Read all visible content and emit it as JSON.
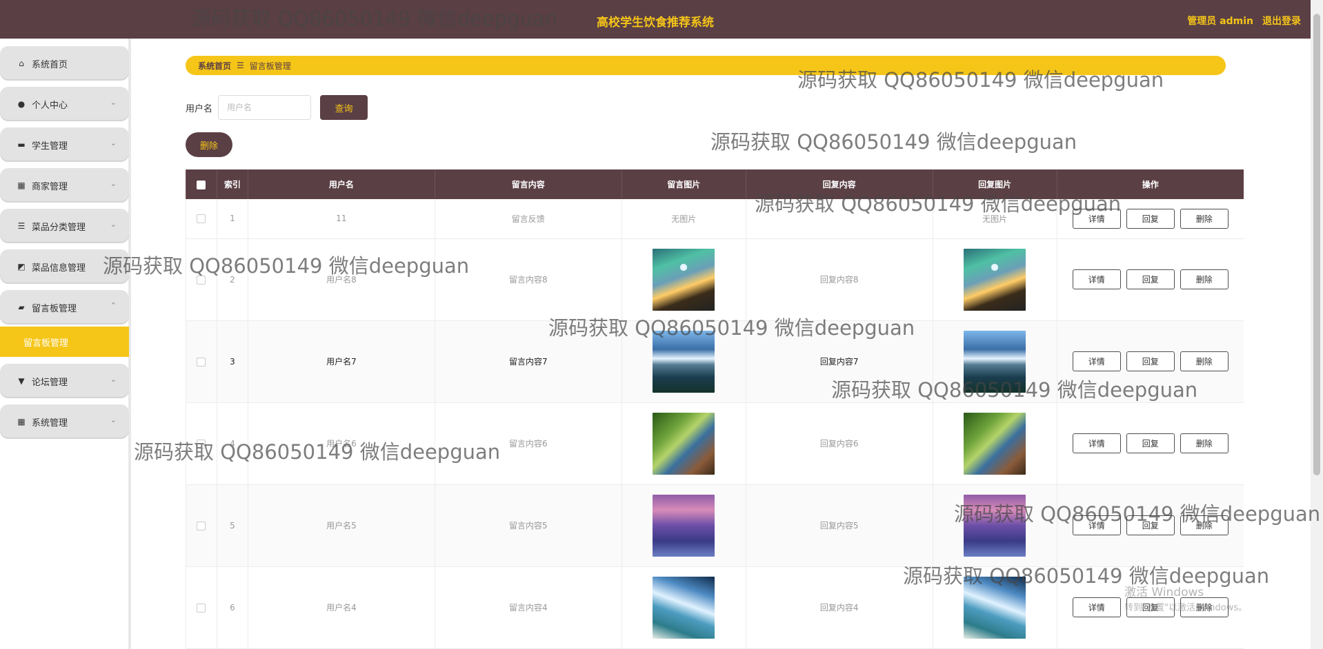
{
  "header": {
    "title": "高校学生饮食推荐系统",
    "admin_label": "管理员 admin",
    "logout_label": "退出登录"
  },
  "sidebar": {
    "items": [
      {
        "label": "系统首页",
        "icon": "home-icon",
        "expandable": false
      },
      {
        "label": "个人中心",
        "icon": "user-icon",
        "expandable": true
      },
      {
        "label": "学生管理",
        "icon": "monitor-icon",
        "expandable": true
      },
      {
        "label": "商家管理",
        "icon": "grid-icon",
        "expandable": true
      },
      {
        "label": "菜品分类管理",
        "icon": "list-icon",
        "expandable": true
      },
      {
        "label": "菜品信息管理",
        "icon": "chart-icon",
        "expandable": true
      },
      {
        "label": "留言板管理",
        "icon": "ticket-icon",
        "expandable": true,
        "expanded": true
      },
      {
        "label": "论坛管理",
        "icon": "pin-icon",
        "expandable": true
      },
      {
        "label": "系统管理",
        "icon": "grid-icon",
        "expandable": true
      }
    ],
    "active_sub_item": "留言板管理"
  },
  "breadcrumb": {
    "home": "系统首页",
    "separator": "☰",
    "current": "留言板管理"
  },
  "search": {
    "label": "用户名",
    "placeholder": "用户名",
    "query_button": "查询",
    "delete_button": "删除"
  },
  "table": {
    "columns": [
      "索引",
      "用户名",
      "留言内容",
      "留言图片",
      "回复内容",
      "回复图片",
      "操作"
    ],
    "actions": [
      "详情",
      "回复",
      "删除"
    ],
    "rows": [
      {
        "index": "1",
        "username": "11",
        "content": "留言反馈",
        "image_text": "无图片",
        "reply": "",
        "reply_image_text": "无图片"
      },
      {
        "index": "2",
        "username": "用户名8",
        "content": "留言内容8",
        "image": "img1",
        "reply": "回复内容8",
        "reply_image": "img1"
      },
      {
        "index": "3",
        "username": "用户名7",
        "content": "留言内容7",
        "image": "img2",
        "reply": "回复内容7",
        "reply_image": "img2"
      },
      {
        "index": "4",
        "username": "用户名6",
        "content": "留言内容6",
        "image": "img3",
        "reply": "回复内容6",
        "reply_image": "img3"
      },
      {
        "index": "5",
        "username": "用户名5",
        "content": "留言内容5",
        "image": "img4",
        "reply": "回复内容5",
        "reply_image": "img4"
      },
      {
        "index": "6",
        "username": "用户名4",
        "content": "留言内容4",
        "image": "img5",
        "reply": "回复内容4",
        "reply_image": "img5"
      }
    ]
  },
  "watermark": "源码获取 QQ86050149 微信deepguan",
  "windows_activation": {
    "title": "激活 Windows",
    "subtitle": "转到\"设置\"以激活 Windows。"
  }
}
